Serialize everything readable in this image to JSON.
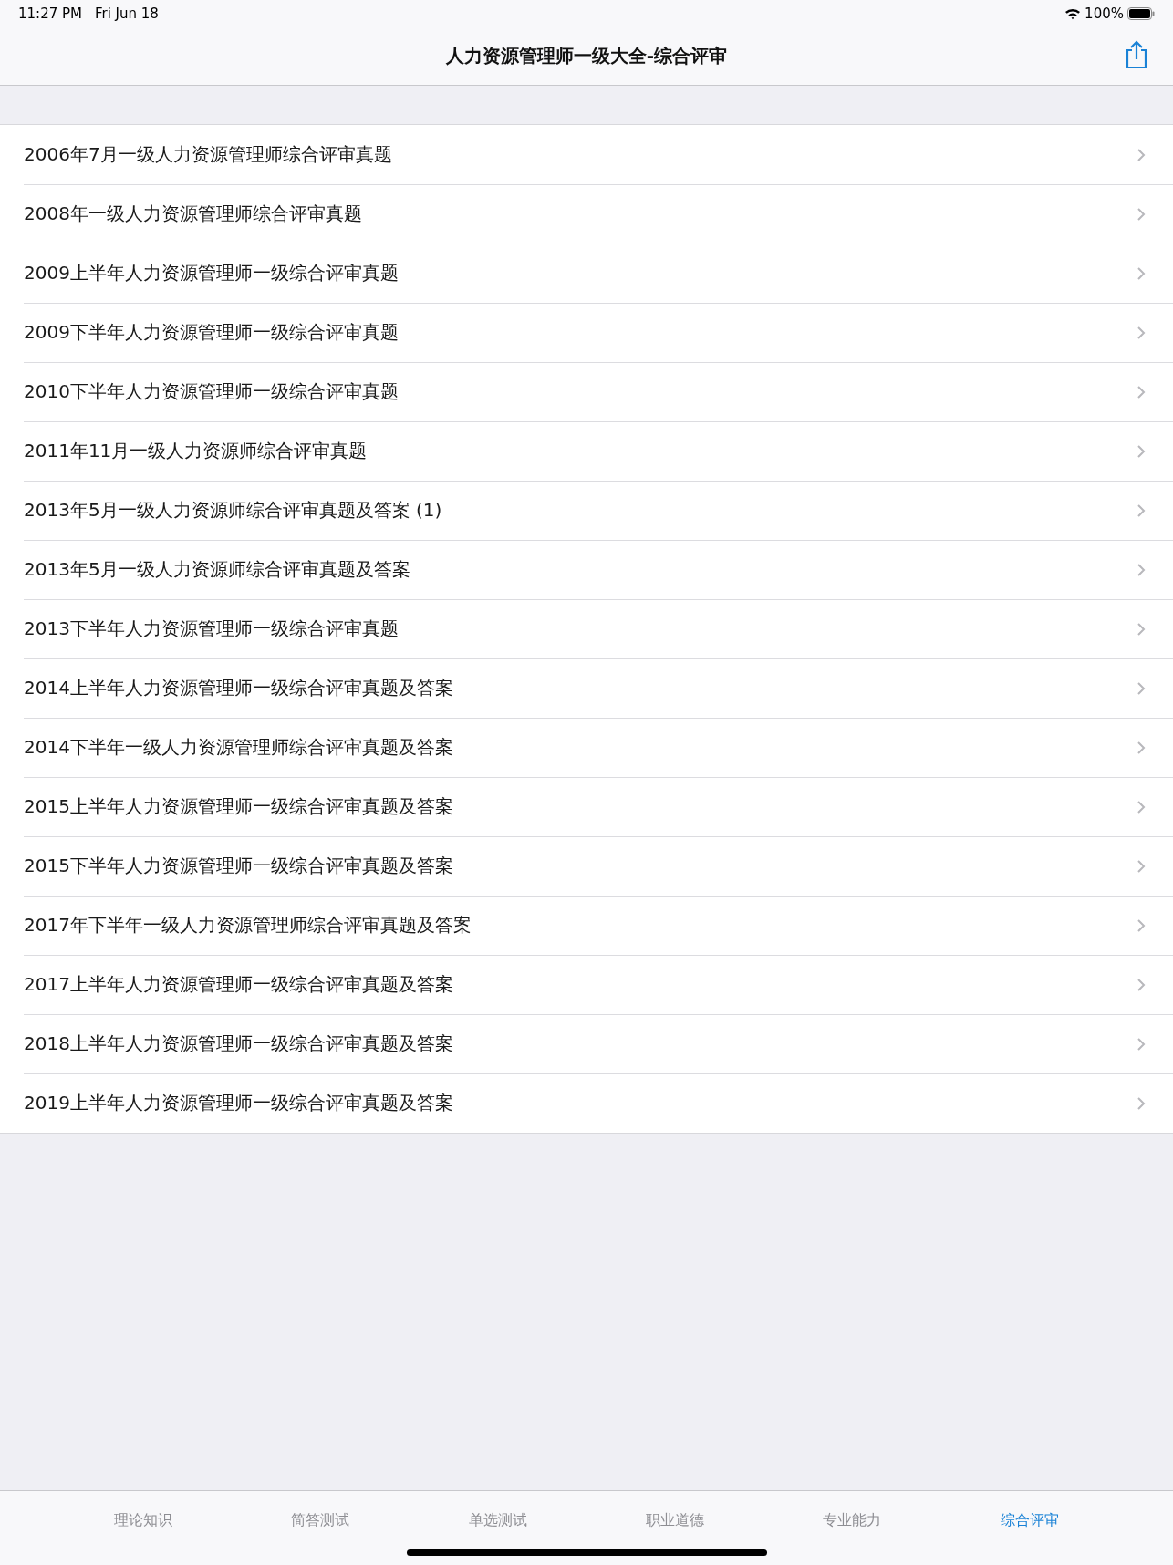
{
  "status_bar": {
    "time": "11:27 PM",
    "date": "Fri Jun 18",
    "battery": "100%"
  },
  "nav_bar": {
    "title": "人力资源管理师一级大全-综合评审"
  },
  "list": [
    {
      "title": "2006年7月一级人力资源管理师综合评审真题"
    },
    {
      "title": "2008年一级人力资源管理师综合评审真题"
    },
    {
      "title": "2009上半年人力资源管理师一级综合评审真题"
    },
    {
      "title": "2009下半年人力资源管理师一级综合评审真题"
    },
    {
      "title": "2010下半年人力资源管理师一级综合评审真题"
    },
    {
      "title": "2011年11月一级人力资源师综合评审真题"
    },
    {
      "title": "2013年5月一级人力资源师综合评审真题及答案 (1)"
    },
    {
      "title": "2013年5月一级人力资源师综合评审真题及答案"
    },
    {
      "title": "2013下半年人力资源管理师一级综合评审真题"
    },
    {
      "title": "2014上半年人力资源管理师一级综合评审真题及答案"
    },
    {
      "title": "2014下半年一级人力资源管理师综合评审真题及答案"
    },
    {
      "title": "2015上半年人力资源管理师一级综合评审真题及答案"
    },
    {
      "title": "2015下半年人力资源管理师一级综合评审真题及答案"
    },
    {
      "title": "2017年下半年一级人力资源管理师综合评审真题及答案"
    },
    {
      "title": "2017上半年人力资源管理师一级综合评审真题及答案"
    },
    {
      "title": "2018上半年人力资源管理师一级综合评审真题及答案"
    },
    {
      "title": "2019上半年人力资源管理师一级综合评审真题及答案"
    }
  ],
  "tabs": [
    {
      "label": "理论知识",
      "selected": false
    },
    {
      "label": "简答测试",
      "selected": false
    },
    {
      "label": "单选测试",
      "selected": false
    },
    {
      "label": "职业道德",
      "selected": false
    },
    {
      "label": "专业能力",
      "selected": false
    },
    {
      "label": "综合评审",
      "selected": true
    }
  ]
}
